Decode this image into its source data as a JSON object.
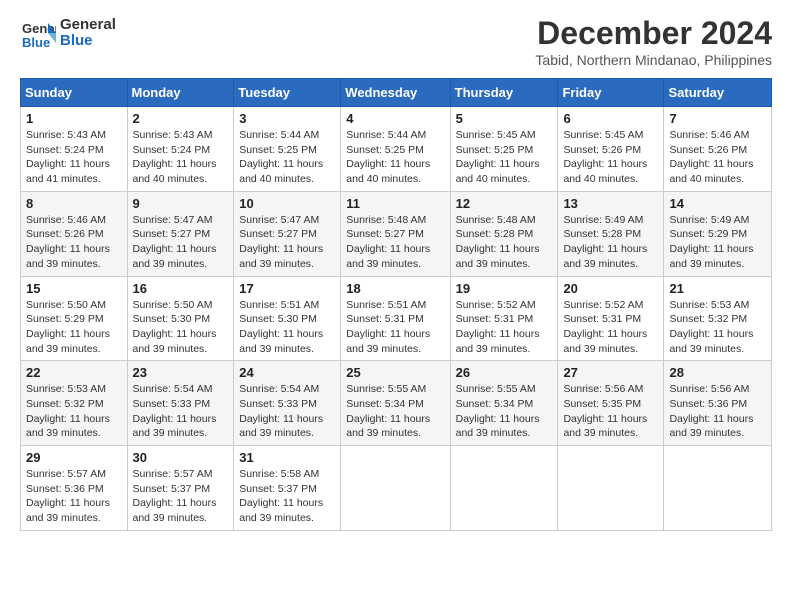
{
  "header": {
    "logo_line1": "General",
    "logo_line2": "Blue",
    "title": "December 2024",
    "subtitle": "Tabid, Northern Mindanao, Philippines"
  },
  "calendar": {
    "columns": [
      "Sunday",
      "Monday",
      "Tuesday",
      "Wednesday",
      "Thursday",
      "Friday",
      "Saturday"
    ],
    "weeks": [
      [
        {
          "day": "",
          "detail": ""
        },
        {
          "day": "2",
          "detail": "Sunrise: 5:43 AM\nSunset: 5:24 PM\nDaylight: 11 hours\nand 40 minutes."
        },
        {
          "day": "3",
          "detail": "Sunrise: 5:44 AM\nSunset: 5:25 PM\nDaylight: 11 hours\nand 40 minutes."
        },
        {
          "day": "4",
          "detail": "Sunrise: 5:44 AM\nSunset: 5:25 PM\nDaylight: 11 hours\nand 40 minutes."
        },
        {
          "day": "5",
          "detail": "Sunrise: 5:45 AM\nSunset: 5:25 PM\nDaylight: 11 hours\nand 40 minutes."
        },
        {
          "day": "6",
          "detail": "Sunrise: 5:45 AM\nSunset: 5:26 PM\nDaylight: 11 hours\nand 40 minutes."
        },
        {
          "day": "7",
          "detail": "Sunrise: 5:46 AM\nSunset: 5:26 PM\nDaylight: 11 hours\nand 40 minutes."
        }
      ],
      [
        {
          "day": "1",
          "detail": "Sunrise: 5:43 AM\nSunset: 5:24 PM\nDaylight: 11 hours\nand 41 minutes."
        },
        {
          "day": "9",
          "detail": "Sunrise: 5:47 AM\nSunset: 5:27 PM\nDaylight: 11 hours\nand 39 minutes."
        },
        {
          "day": "10",
          "detail": "Sunrise: 5:47 AM\nSunset: 5:27 PM\nDaylight: 11 hours\nand 39 minutes."
        },
        {
          "day": "11",
          "detail": "Sunrise: 5:48 AM\nSunset: 5:27 PM\nDaylight: 11 hours\nand 39 minutes."
        },
        {
          "day": "12",
          "detail": "Sunrise: 5:48 AM\nSunset: 5:28 PM\nDaylight: 11 hours\nand 39 minutes."
        },
        {
          "day": "13",
          "detail": "Sunrise: 5:49 AM\nSunset: 5:28 PM\nDaylight: 11 hours\nand 39 minutes."
        },
        {
          "day": "14",
          "detail": "Sunrise: 5:49 AM\nSunset: 5:29 PM\nDaylight: 11 hours\nand 39 minutes."
        }
      ],
      [
        {
          "day": "8",
          "detail": "Sunrise: 5:46 AM\nSunset: 5:26 PM\nDaylight: 11 hours\nand 39 minutes."
        },
        {
          "day": "16",
          "detail": "Sunrise: 5:50 AM\nSunset: 5:30 PM\nDaylight: 11 hours\nand 39 minutes."
        },
        {
          "day": "17",
          "detail": "Sunrise: 5:51 AM\nSunset: 5:30 PM\nDaylight: 11 hours\nand 39 minutes."
        },
        {
          "day": "18",
          "detail": "Sunrise: 5:51 AM\nSunset: 5:31 PM\nDaylight: 11 hours\nand 39 minutes."
        },
        {
          "day": "19",
          "detail": "Sunrise: 5:52 AM\nSunset: 5:31 PM\nDaylight: 11 hours\nand 39 minutes."
        },
        {
          "day": "20",
          "detail": "Sunrise: 5:52 AM\nSunset: 5:31 PM\nDaylight: 11 hours\nand 39 minutes."
        },
        {
          "day": "21",
          "detail": "Sunrise: 5:53 AM\nSunset: 5:32 PM\nDaylight: 11 hours\nand 39 minutes."
        }
      ],
      [
        {
          "day": "15",
          "detail": "Sunrise: 5:50 AM\nSunset: 5:29 PM\nDaylight: 11 hours\nand 39 minutes."
        },
        {
          "day": "23",
          "detail": "Sunrise: 5:54 AM\nSunset: 5:33 PM\nDaylight: 11 hours\nand 39 minutes."
        },
        {
          "day": "24",
          "detail": "Sunrise: 5:54 AM\nSunset: 5:33 PM\nDaylight: 11 hours\nand 39 minutes."
        },
        {
          "day": "25",
          "detail": "Sunrise: 5:55 AM\nSunset: 5:34 PM\nDaylight: 11 hours\nand 39 minutes."
        },
        {
          "day": "26",
          "detail": "Sunrise: 5:55 AM\nSunset: 5:34 PM\nDaylight: 11 hours\nand 39 minutes."
        },
        {
          "day": "27",
          "detail": "Sunrise: 5:56 AM\nSunset: 5:35 PM\nDaylight: 11 hours\nand 39 minutes."
        },
        {
          "day": "28",
          "detail": "Sunrise: 5:56 AM\nSunset: 5:36 PM\nDaylight: 11 hours\nand 39 minutes."
        }
      ],
      [
        {
          "day": "22",
          "detail": "Sunrise: 5:53 AM\nSunset: 5:32 PM\nDaylight: 11 hours\nand 39 minutes."
        },
        {
          "day": "30",
          "detail": "Sunrise: 5:57 AM\nSunset: 5:37 PM\nDaylight: 11 hours\nand 39 minutes."
        },
        {
          "day": "31",
          "detail": "Sunrise: 5:58 AM\nSunset: 5:37 PM\nDaylight: 11 hours\nand 39 minutes."
        },
        {
          "day": "",
          "detail": ""
        },
        {
          "day": "",
          "detail": ""
        },
        {
          "day": "",
          "detail": ""
        },
        {
          "day": "",
          "detail": ""
        }
      ],
      [
        {
          "day": "29",
          "detail": "Sunrise: 5:57 AM\nSunset: 5:36 PM\nDaylight: 11 hours\nand 39 minutes."
        },
        {
          "day": "",
          "detail": ""
        },
        {
          "day": "",
          "detail": ""
        },
        {
          "day": "",
          "detail": ""
        },
        {
          "day": "",
          "detail": ""
        },
        {
          "day": "",
          "detail": ""
        },
        {
          "day": "",
          "detail": ""
        }
      ]
    ]
  }
}
